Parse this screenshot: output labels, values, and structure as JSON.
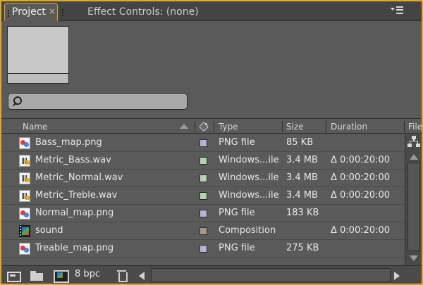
{
  "tabs": {
    "project": {
      "label": "Project",
      "close": "×"
    },
    "effects": {
      "label": "Effect Controls: (none)"
    }
  },
  "search": {
    "placeholder": "",
    "value": ""
  },
  "columns": {
    "name": "Name",
    "type": "Type",
    "size": "Size",
    "duration": "Duration",
    "file": "File"
  },
  "items": [
    {
      "name": "Bass_map.png",
      "icon": "png-file-icon",
      "label_color": "#b5b3d6",
      "type": "PNG file",
      "size": "85 KB",
      "duration": ""
    },
    {
      "name": "Metric_Bass.wav",
      "icon": "audio-file-icon",
      "label_color": "#b9d2b6",
      "type": "Windows...ile",
      "size": "3.4 MB",
      "duration": "Δ 0:00:20:00"
    },
    {
      "name": "Metric_Normal.wav",
      "icon": "audio-file-icon",
      "label_color": "#b9d2b6",
      "type": "Windows...ile",
      "size": "3.4 MB",
      "duration": "Δ 0:00:20:00"
    },
    {
      "name": "Metric_Treble.wav",
      "icon": "audio-file-icon",
      "label_color": "#b9d2b6",
      "type": "Windows...ile",
      "size": "3.4 MB",
      "duration": "Δ 0:00:20:00"
    },
    {
      "name": "Normal_map.png",
      "icon": "png-file-icon",
      "label_color": "#b5b3d6",
      "type": "PNG file",
      "size": "183 KB",
      "duration": ""
    },
    {
      "name": "sound",
      "icon": "composition-icon",
      "label_color": "#a89a86",
      "type": "Composition",
      "size": "",
      "duration": "Δ 0:00:20:00"
    },
    {
      "name": "Treable_map.png",
      "icon": "png-file-icon",
      "label_color": "#b5b3d6",
      "type": "PNG file",
      "size": "275 KB",
      "duration": ""
    }
  ],
  "footer": {
    "bpc": "8 bpc"
  },
  "colors": {
    "panel_border": "#e0a824",
    "panel_bg": "#5a5a5a"
  }
}
